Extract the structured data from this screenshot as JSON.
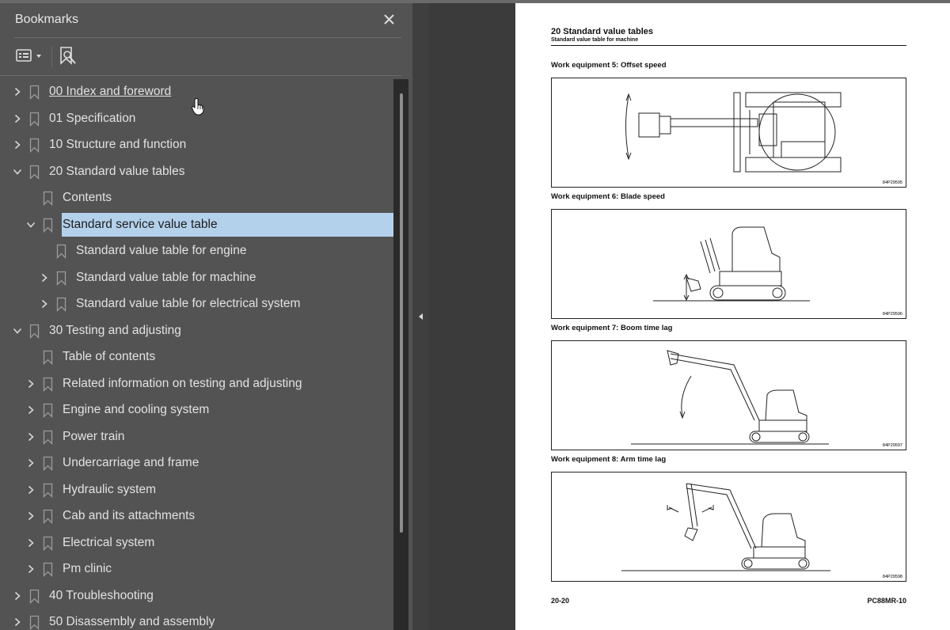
{
  "panel": {
    "title": "Bookmarks",
    "close_icon": "close-icon",
    "options_icon": "options-menu-icon",
    "find_bookmark_icon": "find-bookmark-icon"
  },
  "bookmarks": [
    {
      "label": "00 Index and foreword",
      "level": 0,
      "expander": "collapsed",
      "link": true
    },
    {
      "label": "01 Specification",
      "level": 0,
      "expander": "collapsed"
    },
    {
      "label": "10 Structure and function",
      "level": 0,
      "expander": "collapsed"
    },
    {
      "label": "20 Standard value tables",
      "level": 0,
      "expander": "expanded"
    },
    {
      "label": "Contents",
      "level": 1,
      "expander": "none"
    },
    {
      "label": "Standard service value table",
      "level": 1,
      "expander": "expanded",
      "selected": true
    },
    {
      "label": "Standard value table for engine",
      "level": 2,
      "expander": "none"
    },
    {
      "label": "Standard value table for machine",
      "level": 2,
      "expander": "collapsed"
    },
    {
      "label": "Standard value table for electrical system",
      "level": 2,
      "expander": "collapsed"
    },
    {
      "label": "30 Testing and adjusting",
      "level": 0,
      "expander": "expanded"
    },
    {
      "label": "Table of contents",
      "level": 1,
      "expander": "none"
    },
    {
      "label": "Related information on testing and adjusting",
      "level": 1,
      "expander": "collapsed"
    },
    {
      "label": "Engine and cooling system",
      "level": 1,
      "expander": "collapsed"
    },
    {
      "label": "Power train",
      "level": 1,
      "expander": "collapsed"
    },
    {
      "label": "Undercarriage and frame",
      "level": 1,
      "expander": "collapsed"
    },
    {
      "label": "Hydraulic system",
      "level": 1,
      "expander": "collapsed"
    },
    {
      "label": "Cab and its attachments",
      "level": 1,
      "expander": "collapsed"
    },
    {
      "label": "Electrical system",
      "level": 1,
      "expander": "collapsed"
    },
    {
      "label": "Pm clinic",
      "level": 1,
      "expander": "collapsed"
    },
    {
      "label": "40 Troubleshooting",
      "level": 0,
      "expander": "collapsed"
    },
    {
      "label": "50 Disassembly and assembly",
      "level": 0,
      "expander": "collapsed"
    }
  ],
  "page": {
    "title": "20 Standard value tables",
    "subtitle": "Standard value table for machine",
    "figures": [
      {
        "caption": "Work equipment 5: Offset speed",
        "fig_id": "84P29595"
      },
      {
        "caption": "Work equipment 6: Blade speed",
        "fig_id": "84P29596"
      },
      {
        "caption": "Work equipment 7: Boom time lag",
        "fig_id": "84P29597"
      },
      {
        "caption": "Work equipment 8: Arm time lag",
        "fig_id": "84P29598"
      }
    ],
    "page_number": "20-20",
    "model": "PC88MR-10"
  },
  "colors": {
    "panel_bg": "#535353",
    "selection": "#b4d1ec",
    "page_bg": "#ffffff"
  }
}
